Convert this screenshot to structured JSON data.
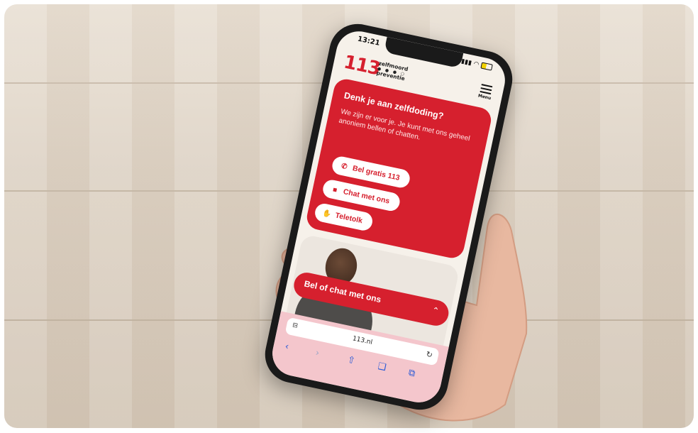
{
  "status": {
    "time": "13:21"
  },
  "brand": {
    "number": "113",
    "line1": "zelfmoord",
    "line2": "preventie",
    "dots": "● ● ● ○"
  },
  "header": {
    "menu_label": "Menu"
  },
  "hero": {
    "title": "Denk je aan zelfdoding?",
    "intro": "We zijn er voor je. Je kunt met ons geheel anoniem bellen of chatten.",
    "buttons": [
      {
        "label": "Bel gratis 113",
        "icon": "phone-icon",
        "glyph": "✆"
      },
      {
        "label": "Chat met ons",
        "icon": "chat-icon",
        "glyph": "■"
      },
      {
        "label": "Teletolk",
        "icon": "hand-icon",
        "glyph": "✋"
      }
    ]
  },
  "chatbar": {
    "label": "Bel of chat met ons",
    "chevron": "⌃"
  },
  "browser": {
    "url": "113.nl",
    "reader": "⊟",
    "reload": "↻",
    "back": "‹",
    "forward": "›",
    "share": "⇧",
    "bookmarks": "❑",
    "tabs": "⧉"
  },
  "colors": {
    "brand_red": "#d6202e",
    "browser_bar": "#f4c6cc"
  }
}
